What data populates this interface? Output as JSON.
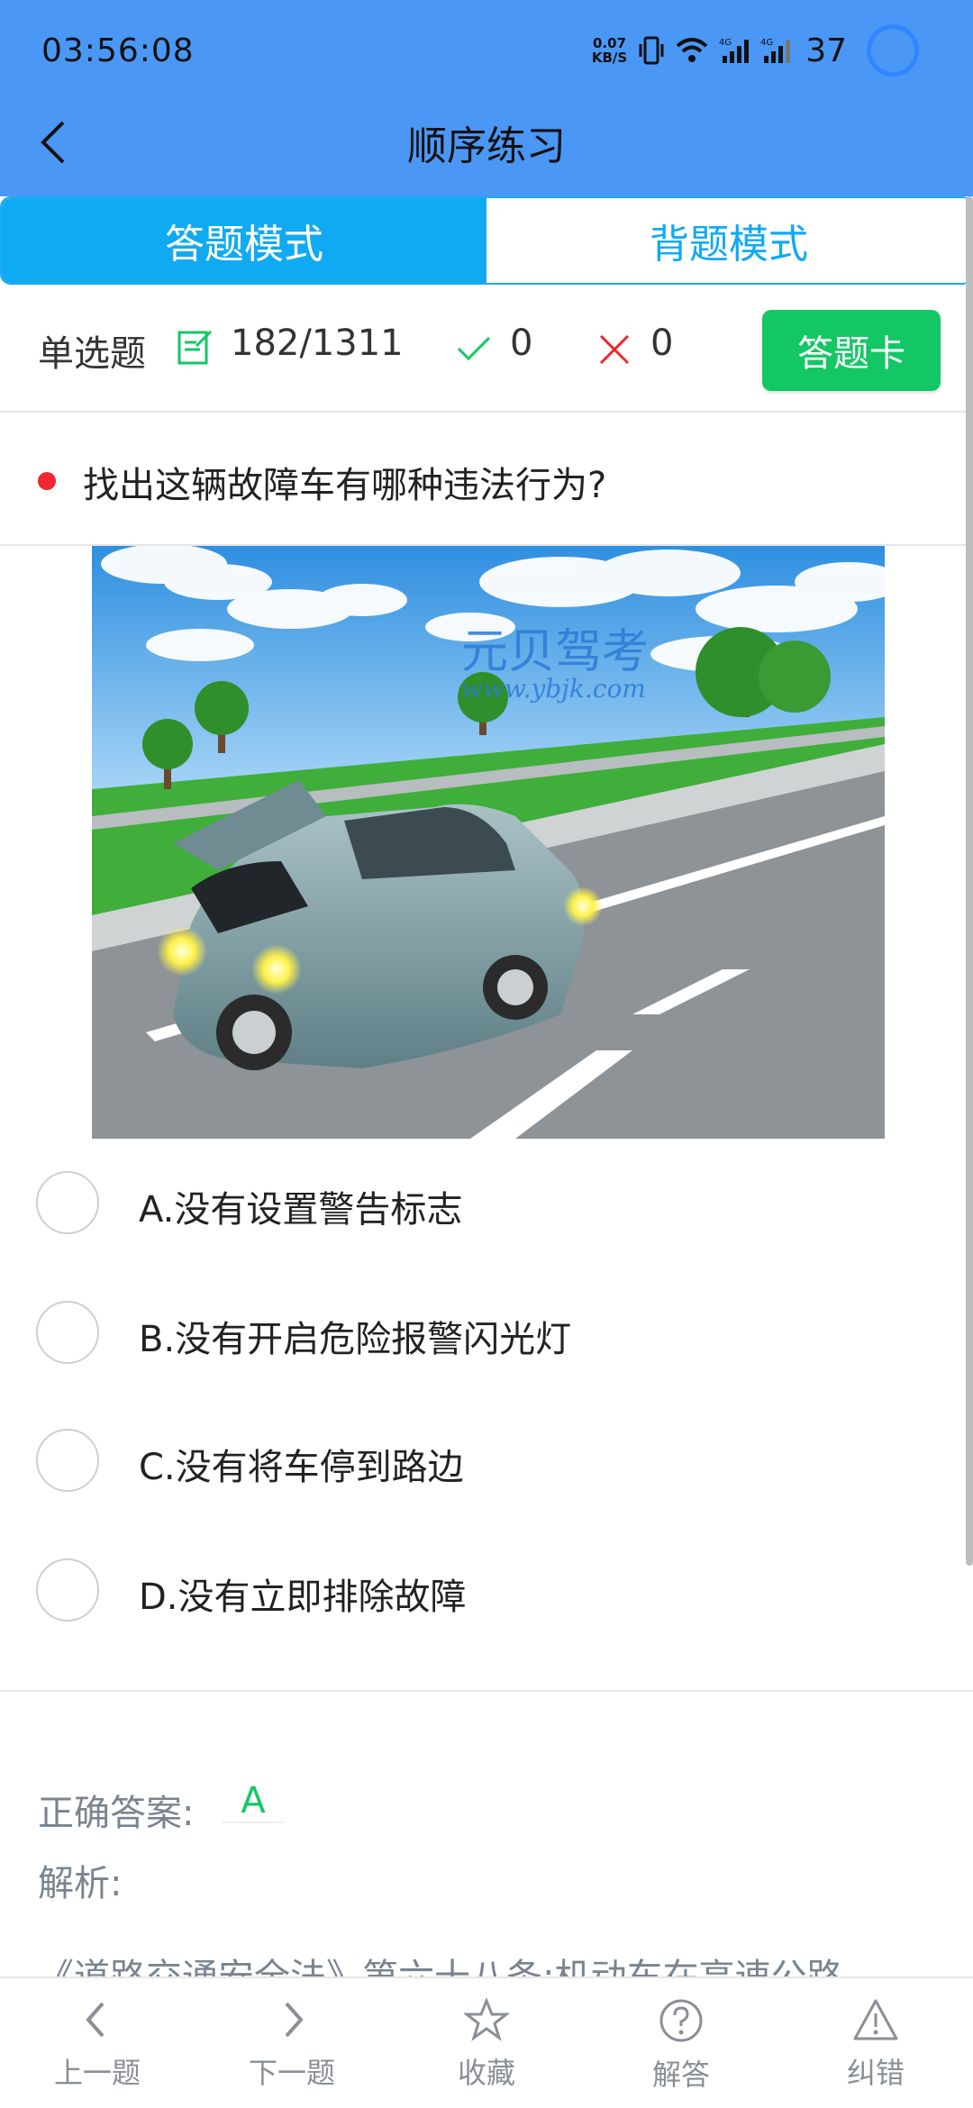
{
  "status_bar": {
    "time": "03:56:08",
    "net_speed_value": "0.07",
    "net_speed_unit": "KB/S",
    "battery": "37"
  },
  "header": {
    "title": "顺序练习"
  },
  "mode_tabs": [
    "答题模式",
    "背题模式"
  ],
  "stats": {
    "question_type": "单选题",
    "progress": "182/1311",
    "correct_count": "0",
    "wrong_count": "0",
    "answer_card_label": "答题卡"
  },
  "question": {
    "text": "找出这辆故障车有哪种违法行为?",
    "image_watermark_title": "元贝驾考",
    "image_watermark_url": "www.ybjk.com"
  },
  "options": [
    {
      "label": "A.没有设置警告标志"
    },
    {
      "label": "B.没有开启危险报警闪光灯"
    },
    {
      "label": "C.没有将车停到路边"
    },
    {
      "label": "D.没有立即排除故障"
    }
  ],
  "answer": {
    "label": "正确答案:",
    "value": "A",
    "analysis_label": "解析:",
    "analysis_text": "《道路交通安全法》第六十八条:机动车在高速公路"
  },
  "bottom_bar": [
    {
      "label": "上一题",
      "icon": "chevron-left-icon"
    },
    {
      "label": "下一题",
      "icon": "chevron-right-icon"
    },
    {
      "label": "收藏",
      "icon": "star-icon"
    },
    {
      "label": "解答",
      "icon": "question-circle-icon"
    },
    {
      "label": "纠错",
      "icon": "warning-triangle-icon"
    }
  ],
  "colors": {
    "header_bg": "#4b97f6",
    "tab_active": "#10aaf2",
    "answer_card": "#13c864",
    "correct": "#13c864",
    "wrong": "#f0262f"
  }
}
